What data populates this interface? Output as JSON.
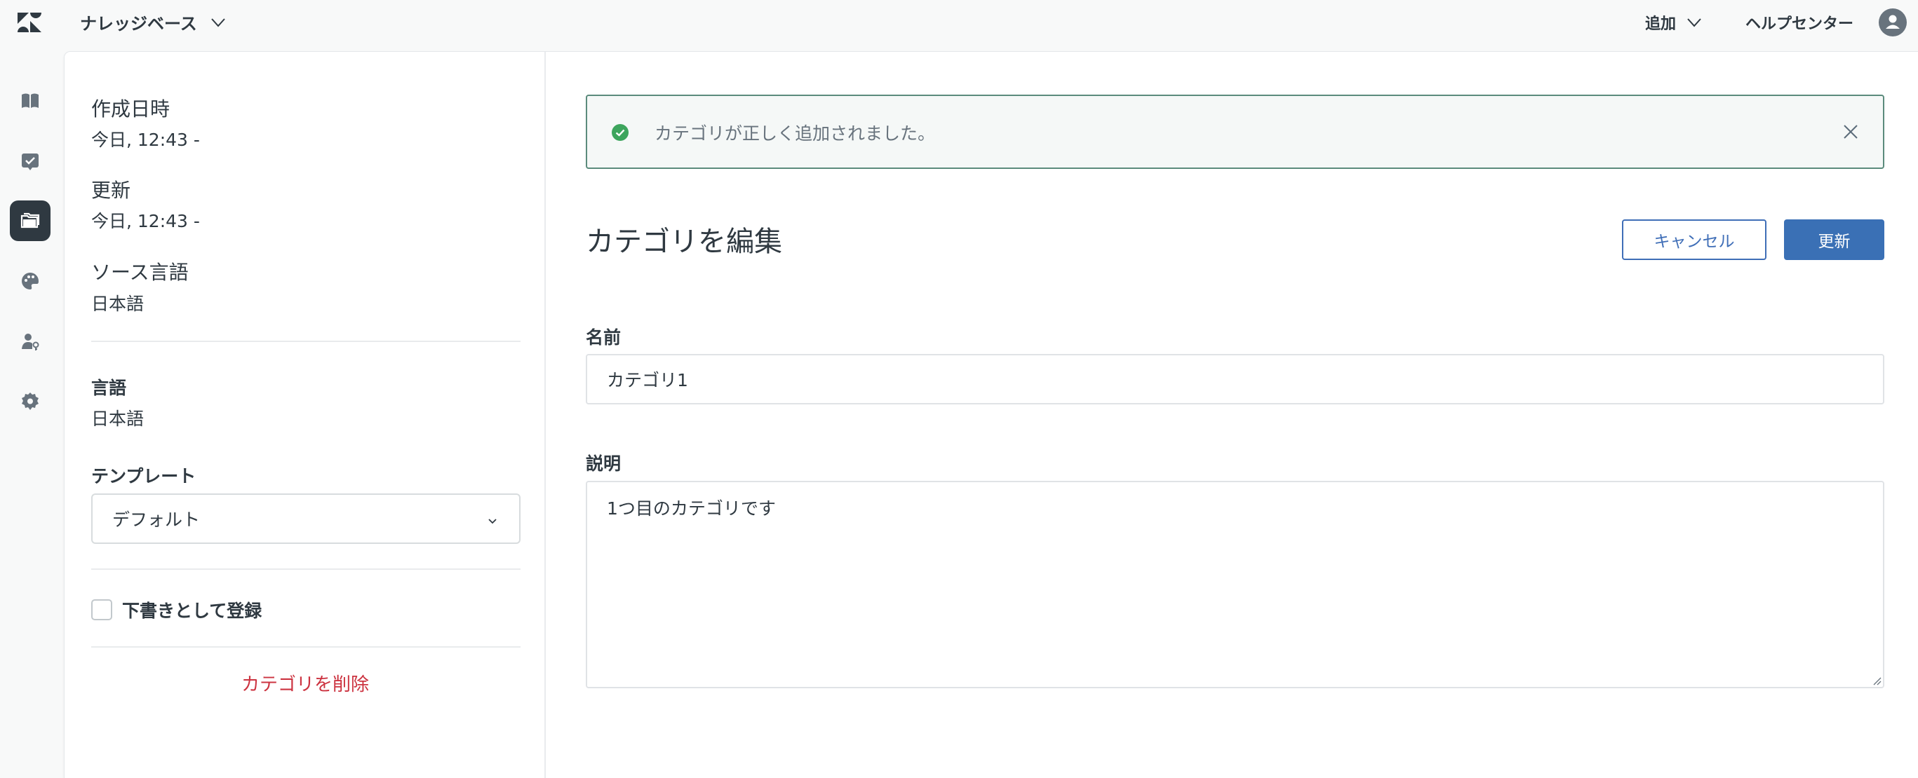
{
  "topbar": {
    "product_name": "ナレッジベース",
    "add_label": "追加",
    "help_center_label": "ヘルプセンター"
  },
  "nav": {
    "items": [
      "guide-icon",
      "tasks-icon",
      "folder-icon",
      "palette-icon",
      "user-permissions-icon",
      "settings-icon"
    ],
    "active": "folder-icon"
  },
  "sidebar": {
    "created_label": "作成日時",
    "created_value": "今日, 12:43 -",
    "updated_label": "更新",
    "updated_value": "今日, 12:43 -",
    "source_language_label": "ソース言語",
    "source_language_value": "日本語",
    "language_label": "言語",
    "language_value": "日本語",
    "template_label": "テンプレート",
    "template_selected": "デフォルト",
    "draft_label": "下書きとして登録",
    "draft_checked": false,
    "delete_label": "カテゴリを削除"
  },
  "main": {
    "alert_message": "カテゴリが正しく追加されました。",
    "title": "カテゴリを編集",
    "cancel_label": "キャンセル",
    "update_label": "更新",
    "name_label": "名前",
    "name_value": "カテゴリ1",
    "description_label": "説明",
    "description_value": "1つ目のカテゴリです"
  },
  "colors": {
    "accent": "#3a70b5",
    "success": "#3da55d",
    "danger": "#cc3340",
    "nav_active": "#2f3941"
  }
}
